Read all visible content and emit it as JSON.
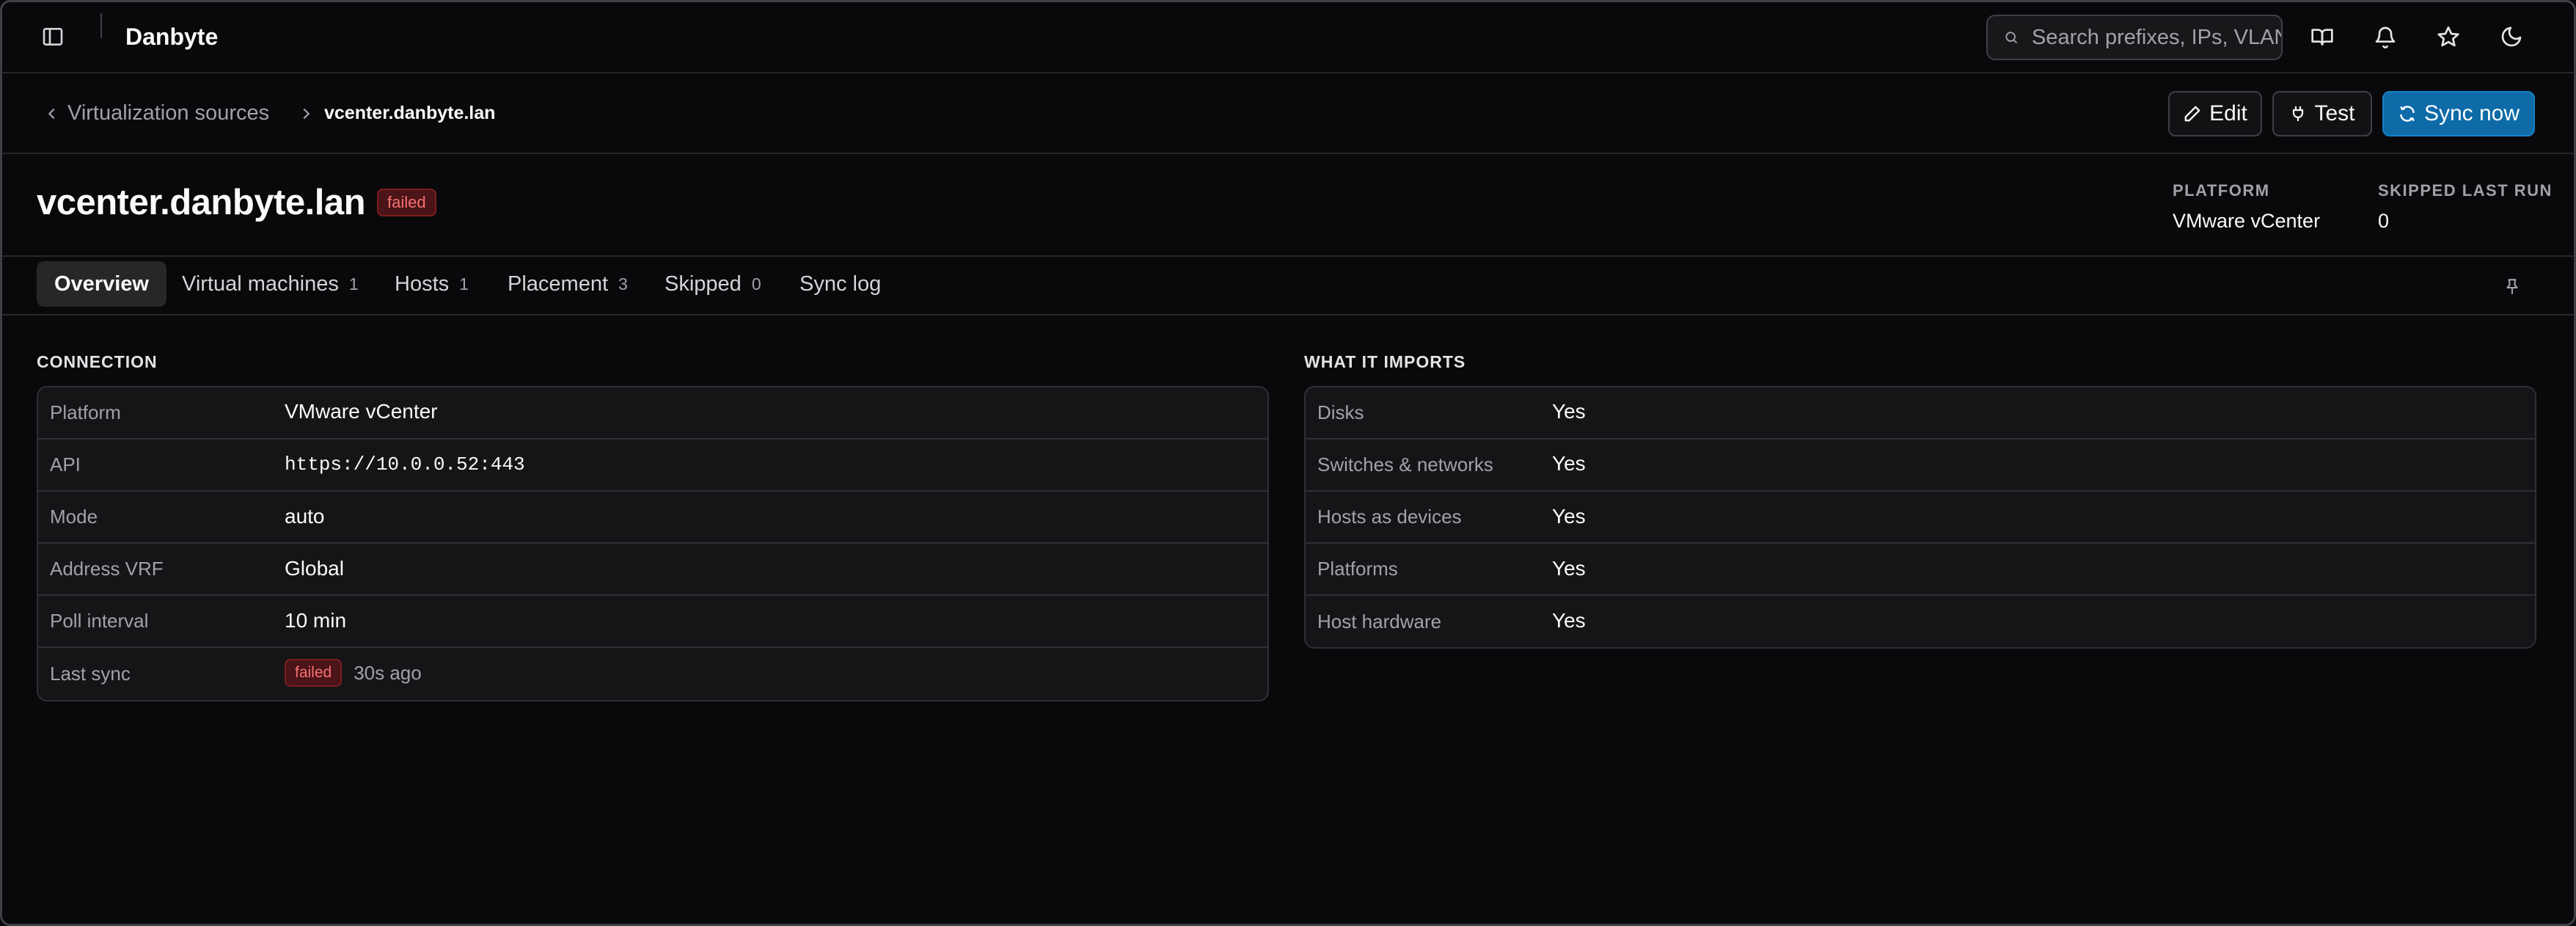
{
  "app": {
    "title": "Danbyte"
  },
  "topbar": {
    "search_placeholder": "Search prefixes, IPs, VLANs...",
    "icons": [
      "panel-left-icon",
      "book-icon",
      "bell-icon",
      "star-icon",
      "moon-icon"
    ]
  },
  "breadcrumb": {
    "parent": "Virtualization sources",
    "current": "vcenter.danbyte.lan"
  },
  "actions": {
    "edit": "Edit",
    "test": "Test",
    "sync": "Sync now"
  },
  "header": {
    "title": "vcenter.danbyte.lan",
    "status": "failed",
    "meta": [
      {
        "label": "PLATFORM",
        "value": "VMware vCenter"
      },
      {
        "label": "SKIPPED LAST RUN",
        "value": "0"
      }
    ]
  },
  "tabs": [
    {
      "label": "Overview",
      "count": ""
    },
    {
      "label": "Virtual machines",
      "count": "1"
    },
    {
      "label": "Hosts",
      "count": "1"
    },
    {
      "label": "Placement",
      "count": "3"
    },
    {
      "label": "Skipped",
      "count": "0"
    },
    {
      "label": "Sync log",
      "count": ""
    }
  ],
  "connection": {
    "title": "CONNECTION",
    "rows": [
      {
        "label": "Platform",
        "value": "VMware vCenter"
      },
      {
        "label": "API",
        "value": "https://10.0.0.52:443"
      },
      {
        "label": "Mode",
        "value": "auto"
      },
      {
        "label": "Address VRF",
        "value": "Global"
      },
      {
        "label": "Poll interval",
        "value": "10 min"
      },
      {
        "label": "Last sync",
        "badge": "failed",
        "value": "30s ago"
      }
    ]
  },
  "imports": {
    "title": "WHAT IT IMPORTS",
    "rows": [
      {
        "label": "Disks",
        "value": "Yes"
      },
      {
        "label": "Switches & networks",
        "value": "Yes"
      },
      {
        "label": "Hosts as devices",
        "value": "Yes"
      },
      {
        "label": "Platforms",
        "value": "Yes"
      },
      {
        "label": "Host hardware",
        "value": "Yes"
      }
    ]
  },
  "colors": {
    "background": "#09090b",
    "accent": "#0e6ba8",
    "danger": "#f87171"
  }
}
